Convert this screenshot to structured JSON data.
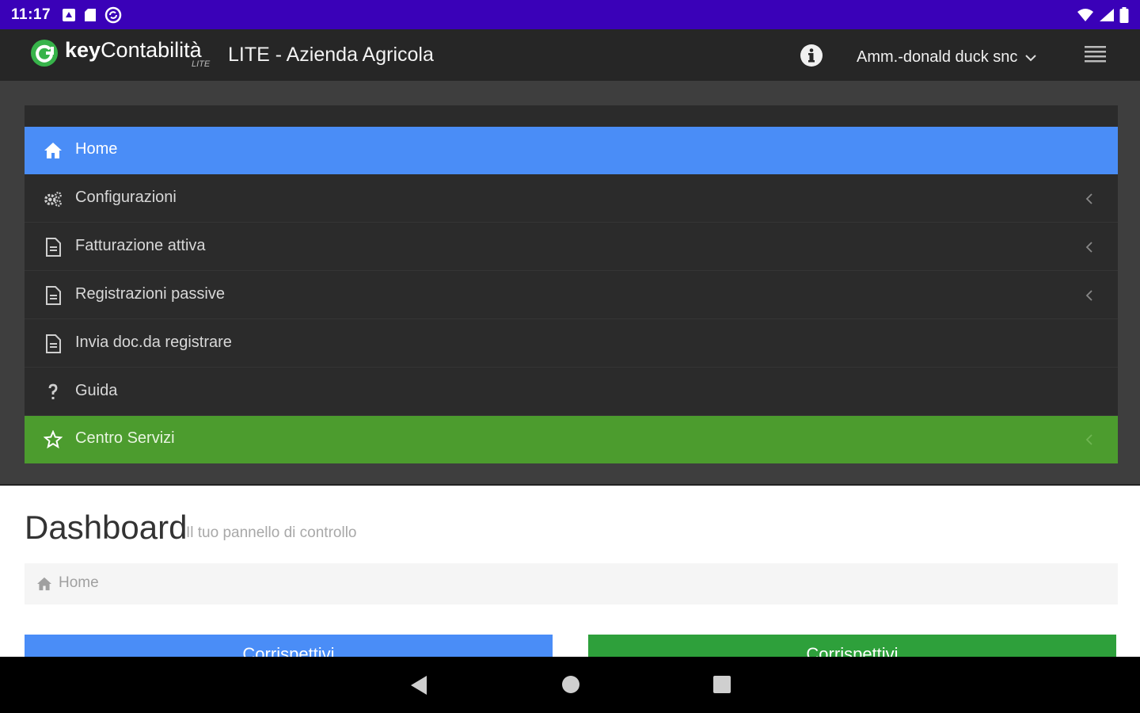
{
  "status_bar": {
    "time": "11:17",
    "icons": [
      "notification-square-icon",
      "sd-card-icon",
      "sync-circle-icon",
      "wifi-icon",
      "signal-icon",
      "battery-icon"
    ]
  },
  "header": {
    "logo_text_bold": "key",
    "logo_text": "Contabilità",
    "logo_sub": "LITE",
    "title": "LITE - Azienda Agricola",
    "user": "Amm.-donald duck snc"
  },
  "sidebar": {
    "items": [
      {
        "label": "Home",
        "icon": "home-icon",
        "active": true,
        "chevron": false
      },
      {
        "label": "Configurazioni",
        "icon": "cogs-icon",
        "chevron": true
      },
      {
        "label": "Fatturazione attiva",
        "icon": "document-icon",
        "chevron": true
      },
      {
        "label": "Registrazioni passive",
        "icon": "document-icon",
        "chevron": true
      },
      {
        "label": "Invia doc.da registrare",
        "icon": "document-icon",
        "chevron": false
      },
      {
        "label": "Guida",
        "icon": "question-icon",
        "chevron": false
      },
      {
        "label": "Centro Servizi",
        "icon": "star-icon",
        "chevron": true
      }
    ]
  },
  "main": {
    "title": "Dashboard",
    "subtitle": "Il tuo pannello di controllo",
    "breadcrumb": "Home",
    "cards": [
      {
        "label": "Corrispettivi"
      },
      {
        "label": "Corrispettivi"
      }
    ]
  },
  "colors": {
    "status_bar": "#3a01b8",
    "app_bar": "#262626",
    "active_item": "#4a8df7",
    "green_item": "#4c9c2e",
    "card_green": "#2ea03b"
  }
}
